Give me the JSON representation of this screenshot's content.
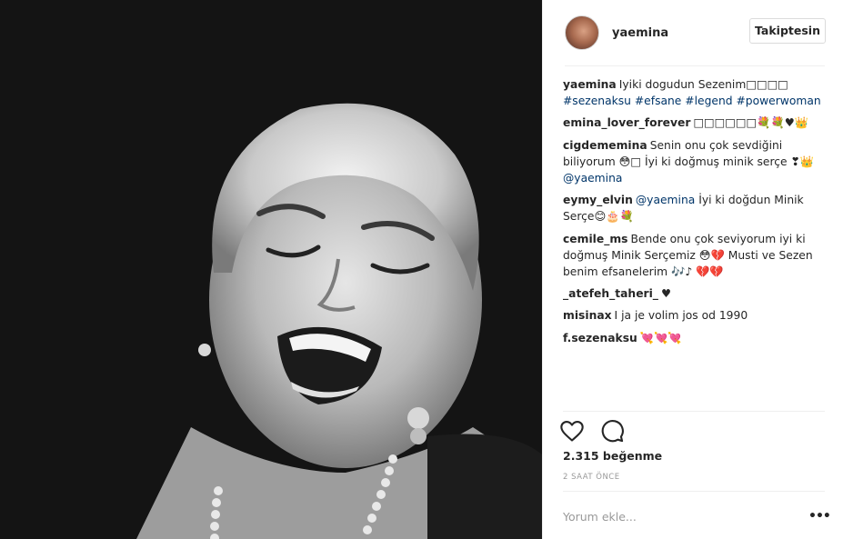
{
  "post": {
    "image_alt": "black and white portrait photo",
    "author": "yaemina",
    "follow_label": "Takiptesin"
  },
  "comments": [
    {
      "user": "yaemina",
      "parts": [
        {
          "t": "Iyiki dogudun Sezenim□□□□ "
        },
        {
          "t": "#sezenaksu",
          "tag": true
        },
        {
          "t": " "
        },
        {
          "t": "#efsane",
          "tag": true
        },
        {
          "t": " "
        },
        {
          "t": "#legend",
          "tag": true
        },
        {
          "t": " "
        },
        {
          "t": "#powerwoman",
          "tag": true
        }
      ]
    },
    {
      "user": "emina_lover_forever",
      "parts": [
        {
          "t": "□□□□□□💐💐♥👑"
        }
      ]
    },
    {
      "user": "cigdememina",
      "parts": [
        {
          "t": "Senin onu çok sevdiğini biliyorum 😳□ İyi ki doğmuş minik serçe ❣👑 "
        },
        {
          "t": "@yaemina",
          "tag": true
        }
      ]
    },
    {
      "user": "eymy_elvin",
      "parts": [
        {
          "t": "@yaemina",
          "tag": true
        },
        {
          "t": " İyi ki doğdun Minik Serçe😊🎂💐"
        }
      ]
    },
    {
      "user": "cemile_ms",
      "parts": [
        {
          "t": "Bende onu çok seviyorum iyi ki doğmuş Minik Serçemiz 😳💔 Musti ve Sezen benim efsanelerim 🎶♪ 💔💔"
        }
      ]
    },
    {
      "user": "_atefeh_taheri_",
      "parts": [
        {
          "t": "♥"
        }
      ]
    },
    {
      "user": "misinax",
      "parts": [
        {
          "t": "I ja je volim jos od 1990"
        }
      ]
    },
    {
      "user": "f.sezenaksu",
      "parts": [
        {
          "t": "💘💘💘"
        }
      ]
    }
  ],
  "actions": {
    "like_icon": "heart-icon",
    "comment_icon": "comment-bubble-icon",
    "likes_text": "2.315 beğenme",
    "time_text": "2 SAAT ÖNCE"
  },
  "composer": {
    "placeholder": "Yorum ekle...",
    "more_label": "•••"
  }
}
